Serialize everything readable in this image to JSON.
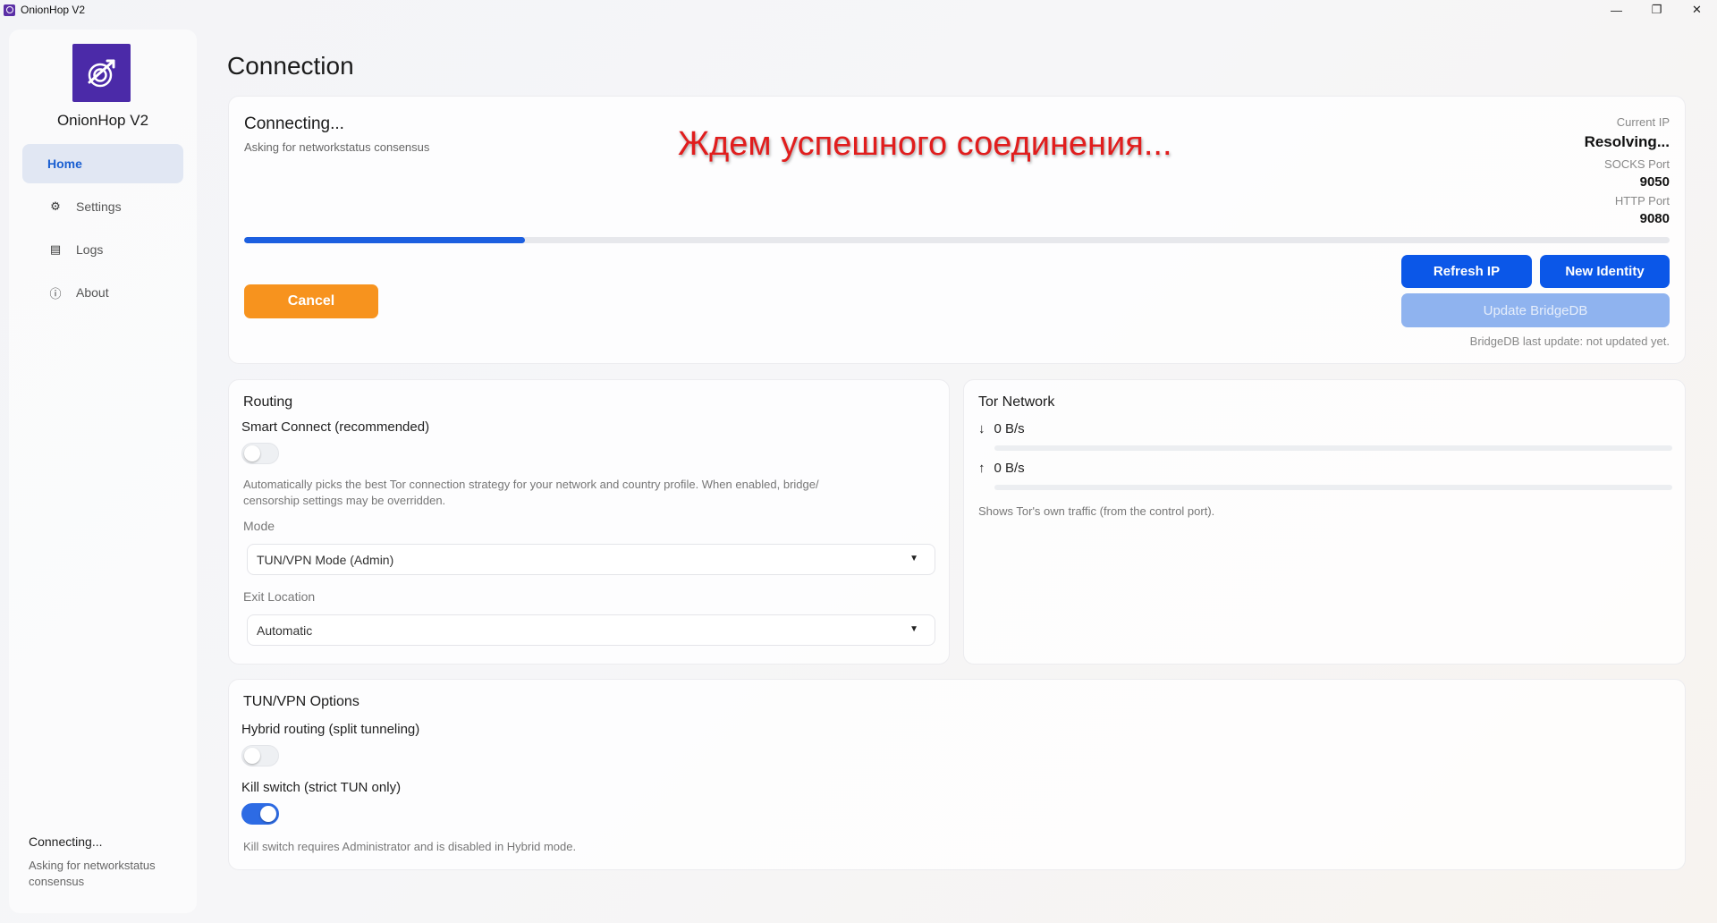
{
  "window": {
    "title": "OnionHop V2",
    "controls": {
      "minimize": "—",
      "maximize": "❐",
      "close": "✕"
    }
  },
  "sidebar": {
    "brand": "OnionHop V2",
    "items": [
      {
        "label": "Home",
        "icon": "home",
        "active": true
      },
      {
        "label": "Settings",
        "icon": "gear-icon"
      },
      {
        "label": "Logs",
        "icon": "list-icon"
      },
      {
        "label": "About",
        "icon": "info-icon"
      }
    ],
    "status_title": "Connecting...",
    "status_sub": "Asking for networkstatus consensus"
  },
  "main": {
    "page_title": "Connection",
    "connection": {
      "status": "Connecting...",
      "detail": "Asking for networkstatus consensus",
      "overlay": "Ждем успешного соединения...",
      "current_ip_label": "Current IP",
      "current_ip_value": "Resolving...",
      "socks_label": "SOCKS Port",
      "socks_value": "9050",
      "http_label": "HTTP Port",
      "http_value": "9080",
      "progress": 0.197,
      "cancel_label": "Cancel",
      "refresh_label": "Refresh IP",
      "new_identity_label": "New Identity",
      "update_bridge_label": "Update BridgeDB",
      "bridge_note": "BridgeDB last update: not updated yet."
    },
    "routing": {
      "title": "Routing",
      "smart_connect_label": "Smart Connect (recommended)",
      "smart_connect_on": false,
      "smart_connect_desc_1": "Automatically picks the best Tor connection strategy for your network and country profile. When enabled, bridge/",
      "smart_connect_desc_2": "censorship settings may be overridden.",
      "mode_label": "Mode",
      "mode_value": "TUN/VPN Mode (Admin)",
      "exit_label": "Exit Location",
      "exit_value": "Automatic"
    },
    "tor_network": {
      "title": "Tor Network",
      "down_arrow": "↓",
      "down_value": "0 B/s",
      "up_arrow": "↑",
      "up_value": "0 B/s",
      "note": "Shows Tor's own traffic (from the control port)."
    },
    "tun_options": {
      "title": "TUN/VPN Options",
      "hybrid_label": "Hybrid routing (split tunneling)",
      "hybrid_on": false,
      "kill_label": "Kill switch (strict TUN only)",
      "kill_on": true,
      "kill_note": "Kill switch requires Administrator and is disabled in Hybrid mode."
    }
  },
  "colors": {
    "accent_blue": "#0b57e8",
    "cancel_orange": "#f7931e",
    "overlay_red": "#e11d1d",
    "logo_purple": "#4b2aa8"
  }
}
